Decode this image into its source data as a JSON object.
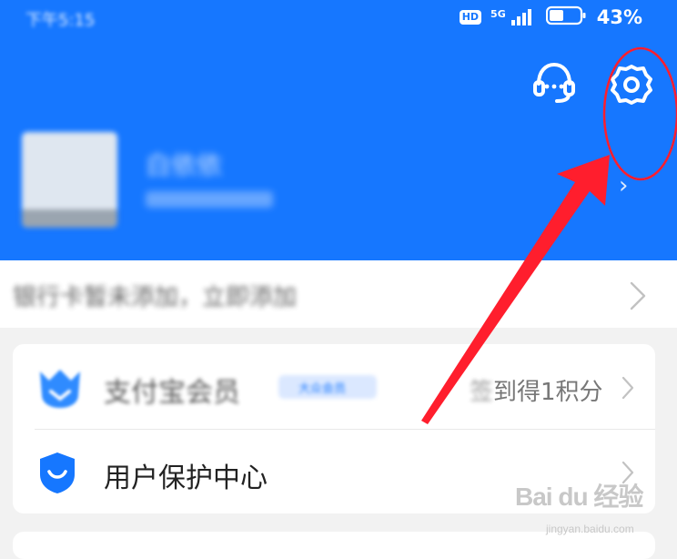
{
  "status_bar": {
    "time": "下午5:15",
    "hd": "HD",
    "network": "5G",
    "battery": "43%"
  },
  "header": {
    "support_icon": "headset-icon",
    "settings_icon": "gear-icon",
    "background_color": "#1677ff"
  },
  "profile": {
    "name": "白依依",
    "sub": "",
    "chevron": "›"
  },
  "bind_bar": {
    "text": "银行卡暂未添加，立即添加",
    "chevron": "chevron-right-icon"
  },
  "menu": {
    "member": {
      "label": "支付宝会员",
      "tag": "大众会员",
      "right_blur": "签",
      "right": "到得1积分",
      "icon": "member-crown-icon"
    },
    "protection": {
      "label": "用户保护中心",
      "icon": "shield-icon"
    }
  },
  "annotation": {
    "color": "#ff1e2d"
  },
  "watermark": {
    "text": "Bai du 经验",
    "sub": "jingyan.baidu.com"
  }
}
